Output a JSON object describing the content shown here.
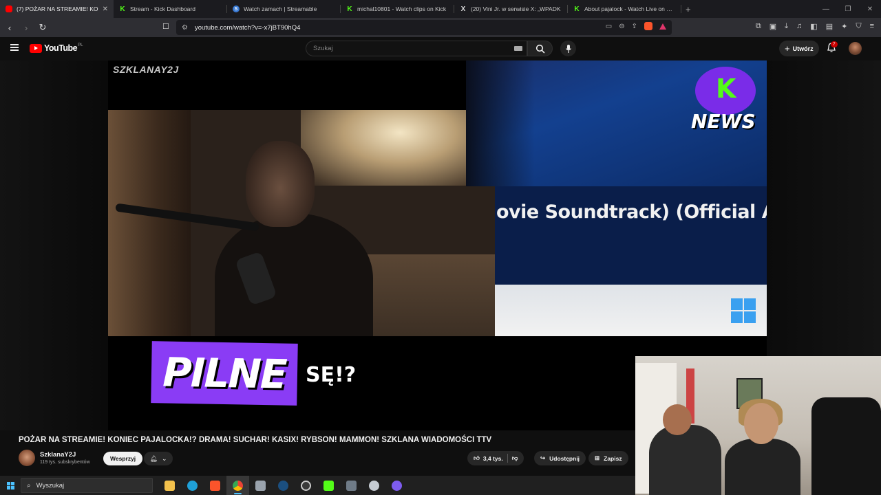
{
  "browser": {
    "tabs": [
      {
        "label": "(7) POŻAR NA STREAMIE! KO",
        "icon": "youtube-icon",
        "active": true
      },
      {
        "label": "Stream - Kick Dashboard",
        "icon": "kick-icon"
      },
      {
        "label": "Watch zamach | Streamable",
        "icon": "streamable-icon"
      },
      {
        "label": "michal10801 - Watch clips on Kick",
        "icon": "kick-icon"
      },
      {
        "label": "(20) Vini Jr. w serwisie X: „WPADK",
        "icon": "x-icon"
      },
      {
        "label": "About pajalock - Watch Live on Kick",
        "icon": "kick-icon"
      }
    ],
    "url": "youtube.com/watch?v=-x7jBT90hQ4"
  },
  "youtube": {
    "logo_text": "YouTube",
    "country_code": "PL",
    "search_placeholder": "Szukaj",
    "create_label": "Utwórz",
    "notifications_count": "7"
  },
  "video": {
    "channel_watermark": "SZKLANAY2J",
    "news_word": "NEWS",
    "song_fragment": "ovie Soundtrack) (Official Au",
    "pilne_label": "PILNE",
    "caption_fragment": "SĘ!?",
    "title": "POŻAR NA STREAMIE! KONIEC PAJALOCKA!? DRAMA! SUCHAR! KASIX! RYBSON! MAMMON! SZKLANA WIADOMOŚCI TTV"
  },
  "channel": {
    "name": "SzklanaY2J",
    "subscribers": "119 tys. subskrybentów",
    "support_label": "Wesprzyj"
  },
  "actions": {
    "likes": "3,4 tys.",
    "share_label": "Udostępnij",
    "save_label": "Zapisz"
  },
  "taskbar": {
    "search_placeholder": "Wyszukaj"
  },
  "colors": {
    "youtube_red": "#ff0000",
    "kick_green": "#53fc18",
    "pilne_purple": "#8a3cf5",
    "windows_blue": "#4cc2ff"
  }
}
